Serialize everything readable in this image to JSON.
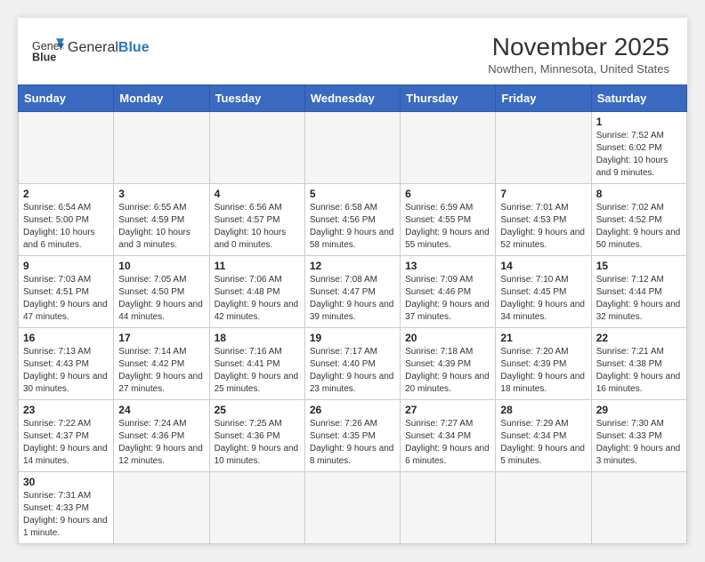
{
  "header": {
    "logo_text_normal": "General",
    "logo_text_bold": "Blue",
    "month_year": "November 2025",
    "location": "Nowthen, Minnesota, United States"
  },
  "days_of_week": [
    "Sunday",
    "Monday",
    "Tuesday",
    "Wednesday",
    "Thursday",
    "Friday",
    "Saturday"
  ],
  "weeks": [
    [
      {
        "day": "",
        "info": ""
      },
      {
        "day": "",
        "info": ""
      },
      {
        "day": "",
        "info": ""
      },
      {
        "day": "",
        "info": ""
      },
      {
        "day": "",
        "info": ""
      },
      {
        "day": "",
        "info": ""
      },
      {
        "day": "1",
        "info": "Sunrise: 7:52 AM\nSunset: 6:02 PM\nDaylight: 10 hours and 9 minutes."
      }
    ],
    [
      {
        "day": "2",
        "info": "Sunrise: 6:54 AM\nSunset: 5:00 PM\nDaylight: 10 hours and 6 minutes."
      },
      {
        "day": "3",
        "info": "Sunrise: 6:55 AM\nSunset: 4:59 PM\nDaylight: 10 hours and 3 minutes."
      },
      {
        "day": "4",
        "info": "Sunrise: 6:56 AM\nSunset: 4:57 PM\nDaylight: 10 hours and 0 minutes."
      },
      {
        "day": "5",
        "info": "Sunrise: 6:58 AM\nSunset: 4:56 PM\nDaylight: 9 hours and 58 minutes."
      },
      {
        "day": "6",
        "info": "Sunrise: 6:59 AM\nSunset: 4:55 PM\nDaylight: 9 hours and 55 minutes."
      },
      {
        "day": "7",
        "info": "Sunrise: 7:01 AM\nSunset: 4:53 PM\nDaylight: 9 hours and 52 minutes."
      },
      {
        "day": "8",
        "info": "Sunrise: 7:02 AM\nSunset: 4:52 PM\nDaylight: 9 hours and 50 minutes."
      }
    ],
    [
      {
        "day": "9",
        "info": "Sunrise: 7:03 AM\nSunset: 4:51 PM\nDaylight: 9 hours and 47 minutes."
      },
      {
        "day": "10",
        "info": "Sunrise: 7:05 AM\nSunset: 4:50 PM\nDaylight: 9 hours and 44 minutes."
      },
      {
        "day": "11",
        "info": "Sunrise: 7:06 AM\nSunset: 4:48 PM\nDaylight: 9 hours and 42 minutes."
      },
      {
        "day": "12",
        "info": "Sunrise: 7:08 AM\nSunset: 4:47 PM\nDaylight: 9 hours and 39 minutes."
      },
      {
        "day": "13",
        "info": "Sunrise: 7:09 AM\nSunset: 4:46 PM\nDaylight: 9 hours and 37 minutes."
      },
      {
        "day": "14",
        "info": "Sunrise: 7:10 AM\nSunset: 4:45 PM\nDaylight: 9 hours and 34 minutes."
      },
      {
        "day": "15",
        "info": "Sunrise: 7:12 AM\nSunset: 4:44 PM\nDaylight: 9 hours and 32 minutes."
      }
    ],
    [
      {
        "day": "16",
        "info": "Sunrise: 7:13 AM\nSunset: 4:43 PM\nDaylight: 9 hours and 30 minutes."
      },
      {
        "day": "17",
        "info": "Sunrise: 7:14 AM\nSunset: 4:42 PM\nDaylight: 9 hours and 27 minutes."
      },
      {
        "day": "18",
        "info": "Sunrise: 7:16 AM\nSunset: 4:41 PM\nDaylight: 9 hours and 25 minutes."
      },
      {
        "day": "19",
        "info": "Sunrise: 7:17 AM\nSunset: 4:40 PM\nDaylight: 9 hours and 23 minutes."
      },
      {
        "day": "20",
        "info": "Sunrise: 7:18 AM\nSunset: 4:39 PM\nDaylight: 9 hours and 20 minutes."
      },
      {
        "day": "21",
        "info": "Sunrise: 7:20 AM\nSunset: 4:39 PM\nDaylight: 9 hours and 18 minutes."
      },
      {
        "day": "22",
        "info": "Sunrise: 7:21 AM\nSunset: 4:38 PM\nDaylight: 9 hours and 16 minutes."
      }
    ],
    [
      {
        "day": "23",
        "info": "Sunrise: 7:22 AM\nSunset: 4:37 PM\nDaylight: 9 hours and 14 minutes."
      },
      {
        "day": "24",
        "info": "Sunrise: 7:24 AM\nSunset: 4:36 PM\nDaylight: 9 hours and 12 minutes."
      },
      {
        "day": "25",
        "info": "Sunrise: 7:25 AM\nSunset: 4:36 PM\nDaylight: 9 hours and 10 minutes."
      },
      {
        "day": "26",
        "info": "Sunrise: 7:26 AM\nSunset: 4:35 PM\nDaylight: 9 hours and 8 minutes."
      },
      {
        "day": "27",
        "info": "Sunrise: 7:27 AM\nSunset: 4:34 PM\nDaylight: 9 hours and 6 minutes."
      },
      {
        "day": "28",
        "info": "Sunrise: 7:29 AM\nSunset: 4:34 PM\nDaylight: 9 hours and 5 minutes."
      },
      {
        "day": "29",
        "info": "Sunrise: 7:30 AM\nSunset: 4:33 PM\nDaylight: 9 hours and 3 minutes."
      }
    ],
    [
      {
        "day": "30",
        "info": "Sunrise: 7:31 AM\nSunset: 4:33 PM\nDaylight: 9 hours and 1 minute."
      },
      {
        "day": "",
        "info": ""
      },
      {
        "day": "",
        "info": ""
      },
      {
        "day": "",
        "info": ""
      },
      {
        "day": "",
        "info": ""
      },
      {
        "day": "",
        "info": ""
      },
      {
        "day": "",
        "info": ""
      }
    ]
  ]
}
